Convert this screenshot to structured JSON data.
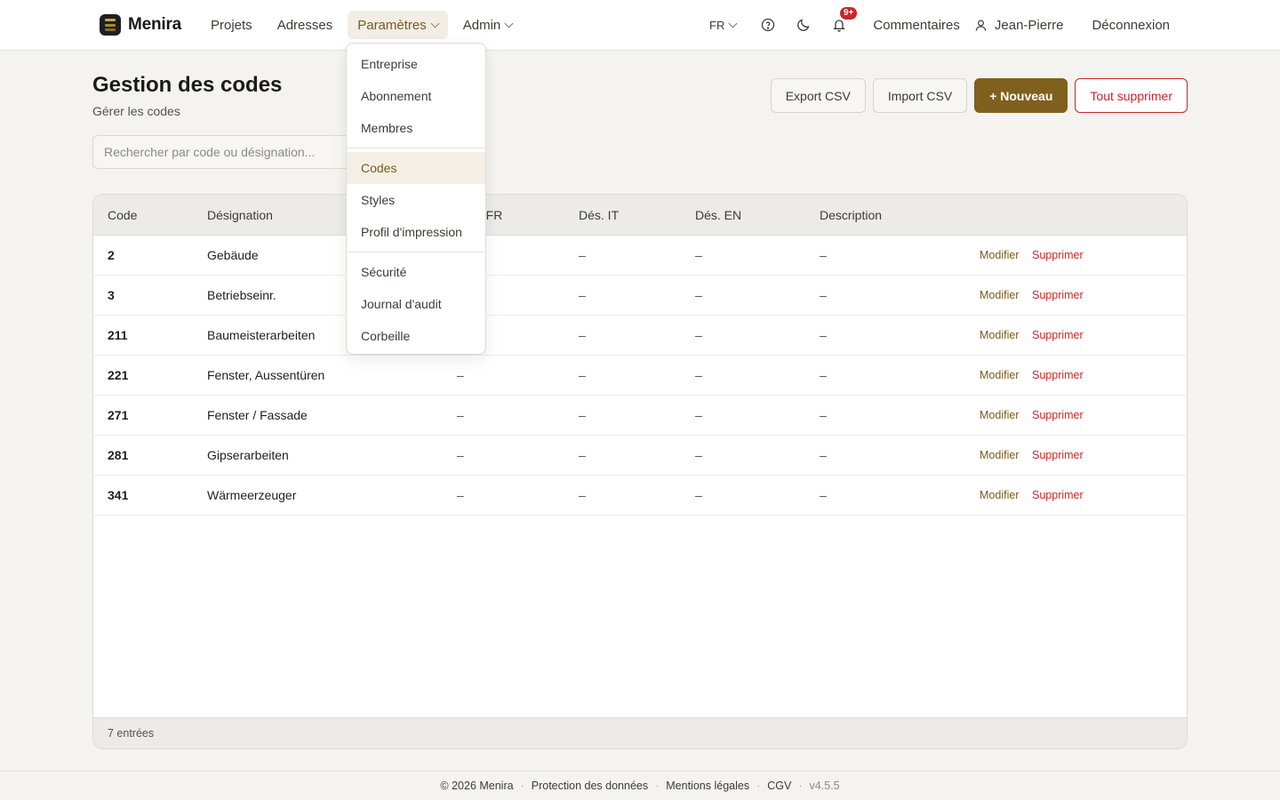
{
  "app": {
    "name": "Menira"
  },
  "nav": {
    "projects": "Projets",
    "addresses": "Adresses",
    "settings": "Paramètres",
    "admin": "Admin"
  },
  "topbar": {
    "language": "FR",
    "notifications_badge": "9+",
    "comments": "Commentaires",
    "user": "Jean-Pierre",
    "logout": "Déconnexion"
  },
  "page": {
    "title": "Gestion des codes",
    "subtitle": "Gérer les codes",
    "search_placeholder": "Rechercher par code ou désignation..."
  },
  "actions": {
    "export": "Export CSV",
    "import": "Import CSV",
    "new": "+ Nouveau",
    "delete_all": "Tout supprimer"
  },
  "table": {
    "headers": {
      "code": "Code",
      "designation": "Désignation",
      "des_fr": "Dés. FR",
      "des_it": "Dés. IT",
      "des_en": "Dés. EN",
      "description": "Description"
    },
    "edit_label": "Modifier",
    "delete_label": "Supprimer",
    "rows": [
      {
        "code": "2",
        "designation": "Gebäude",
        "des_fr": "–",
        "des_it": "–",
        "des_en": "–",
        "description": "–"
      },
      {
        "code": "3",
        "designation": "Betriebseinr.",
        "des_fr": "–",
        "des_it": "–",
        "des_en": "–",
        "description": "–"
      },
      {
        "code": "211",
        "designation": "Baumeisterarbeiten",
        "des_fr": "–",
        "des_it": "–",
        "des_en": "–",
        "description": "–"
      },
      {
        "code": "221",
        "designation": "Fenster, Aussentüren",
        "des_fr": "–",
        "des_it": "–",
        "des_en": "–",
        "description": "–"
      },
      {
        "code": "271",
        "designation": "Fenster / Fassade",
        "des_fr": "–",
        "des_it": "–",
        "des_en": "–",
        "description": "–"
      },
      {
        "code": "281",
        "designation": "Gipserarbeiten",
        "des_fr": "–",
        "des_it": "–",
        "des_en": "–",
        "description": "–"
      },
      {
        "code": "341",
        "designation": "Wärmeerzeuger",
        "des_fr": "–",
        "des_it": "–",
        "des_en": "–",
        "description": "–"
      }
    ],
    "footer": "7 entrées"
  },
  "dropdown": {
    "groups": [
      [
        "Entreprise",
        "Abonnement",
        "Membres"
      ],
      [
        "Codes",
        "Styles",
        "Profil d'impression"
      ],
      [
        "Sécurité",
        "Journal d'audit",
        "Corbeille"
      ]
    ],
    "active": "Codes"
  },
  "footer": {
    "copyright": "© 2026 Menira",
    "privacy": "Protection des données",
    "legal": "Mentions légales",
    "terms": "CGV",
    "version": "v4.5.5"
  },
  "colors": {
    "accent": "#80601f",
    "danger": "#c7262a",
    "background": "#f4f3f0"
  }
}
